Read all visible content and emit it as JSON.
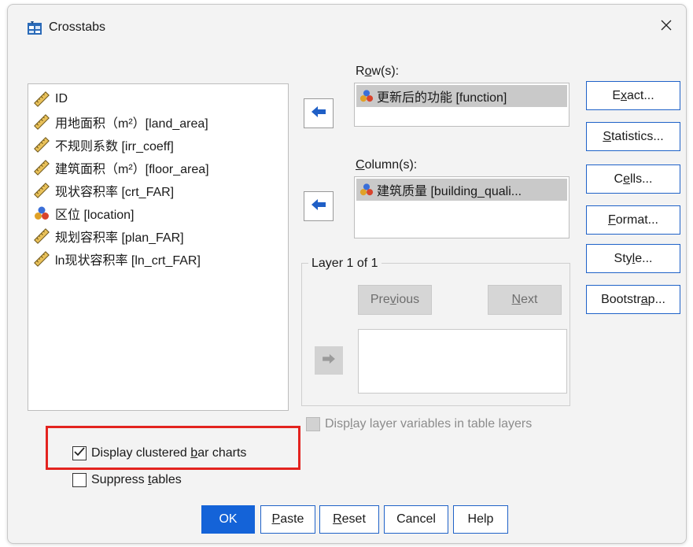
{
  "window": {
    "title": "Crosstabs"
  },
  "variables": [
    {
      "label": "ID",
      "icon": "scale-ruler-icon"
    },
    {
      "label": "用地面积（m²）[land_area]",
      "icon": "scale-ruler-icon"
    },
    {
      "label": "不规则系数 [irr_coeff]",
      "icon": "scale-ruler-icon"
    },
    {
      "label": "建筑面积（m²）[floor_area]",
      "icon": "scale-ruler-icon"
    },
    {
      "label": "现状容积率 [crt_FAR]",
      "icon": "scale-ruler-icon"
    },
    {
      "label": "区位 [location]",
      "icon": "nominal-balls-icon"
    },
    {
      "label": "规划容积率 [plan_FAR]",
      "icon": "scale-ruler-icon"
    },
    {
      "label": "ln现状容积率 [ln_crt_FAR]",
      "icon": "scale-ruler-icon"
    }
  ],
  "rows": {
    "label_pre": "R",
    "label_u": "o",
    "label_post": "w(s):",
    "value": "更新后的功能 [function]"
  },
  "columns": {
    "label_pre": "",
    "label_u": "C",
    "label_post": "olumn(s):",
    "value": "建筑质量 [building_quali..."
  },
  "side_buttons": [
    {
      "pre": "E",
      "u": "x",
      "post": "act..."
    },
    {
      "pre": "",
      "u": "S",
      "post": "tatistics..."
    },
    {
      "pre": "C",
      "u": "e",
      "post": "lls..."
    },
    {
      "pre": "",
      "u": "F",
      "post": "ormat..."
    },
    {
      "pre": "Sty",
      "u": "l",
      "post": "e..."
    },
    {
      "pre": "Bootstr",
      "u": "a",
      "post": "p..."
    }
  ],
  "layer": {
    "title": "Layer 1 of 1",
    "previous": {
      "pre": "Pre",
      "u": "v",
      "post": "ious"
    },
    "next": {
      "pre": "",
      "u": "N",
      "post": "ext"
    }
  },
  "display_layer": {
    "pre": "Disp",
    "u": "l",
    "post": "ay layer variables in table layers",
    "checked": false
  },
  "clustered": {
    "pre": "Display clustered ",
    "u": "b",
    "post": "ar charts",
    "checked": true
  },
  "suppress": {
    "pre": "Suppress ",
    "u": "t",
    "post": "ables",
    "checked": false
  },
  "bottom_buttons": {
    "ok": "OK",
    "paste": {
      "u": "P",
      "post": "aste"
    },
    "reset": {
      "u": "R",
      "post": "eset"
    },
    "cancel": "Cancel",
    "help": "Help"
  },
  "colors": {
    "accent": "#1463d8",
    "highlight": "#e3231f"
  }
}
